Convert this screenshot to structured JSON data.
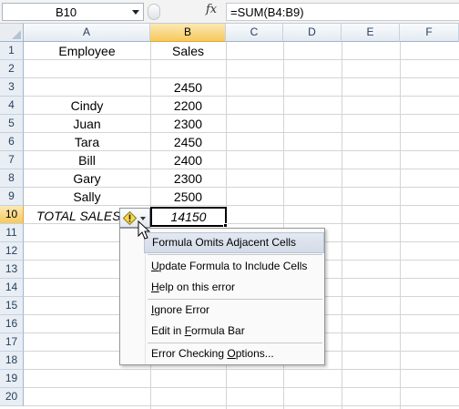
{
  "formula_bar": {
    "name_box": "B10",
    "fx": "fx",
    "formula": "=SUM(B4:B9)"
  },
  "columns": [
    "A",
    "B",
    "C",
    "D",
    "E",
    "F"
  ],
  "rows": [
    "1",
    "2",
    "3",
    "4",
    "5",
    "6",
    "7",
    "8",
    "9",
    "10",
    "11",
    "12",
    "13",
    "14",
    "15",
    "16",
    "17",
    "18",
    "19",
    "20"
  ],
  "cells": {
    "A1": "Employee",
    "B1": "Sales",
    "B3": "2450",
    "A4": "Cindy",
    "B4": "2200",
    "A5": "Juan",
    "B5": "2300",
    "A6": "Tara",
    "B6": "2450",
    "A7": "Bill",
    "B7": "2400",
    "A8": "Gary",
    "B8": "2300",
    "A9": "Sally",
    "B9": "2500",
    "A10": "TOTAL SALES",
    "B10": "14150"
  },
  "selection": {
    "column": "B",
    "row": "10"
  },
  "error_menu": {
    "icon": "warning-diamond-icon",
    "title": "Formula Omits Adjacent Cells",
    "items": [
      {
        "pre": "",
        "key": "U",
        "post": "pdate Formula to Include Cells"
      },
      {
        "pre": "",
        "key": "H",
        "post": "elp on this error"
      },
      {
        "pre": "",
        "key": "I",
        "post": "gnore Error"
      },
      {
        "pre": "Edit in ",
        "key": "F",
        "post": "ormula Bar"
      },
      {
        "pre": "Error Checking ",
        "key": "O",
        "post": "ptions..."
      }
    ]
  },
  "colors": {
    "selected_header": "#f6c95c",
    "grid": "#d4d4d4",
    "header_text": "#27405f"
  }
}
